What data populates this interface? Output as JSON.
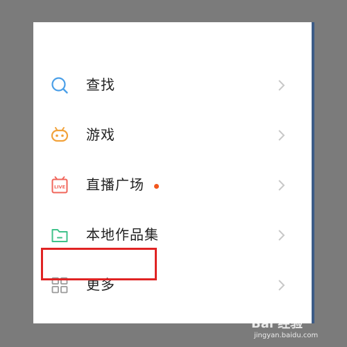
{
  "menu": {
    "items": [
      {
        "label": "查找",
        "icon": "search-icon",
        "icon_color": "#4a9fe8",
        "has_dot": false
      },
      {
        "label": "游戏",
        "icon": "gamepad-icon",
        "icon_color": "#f2a23a",
        "has_dot": false
      },
      {
        "label": "直播广场",
        "icon": "live-tv-icon",
        "icon_color": "#f0645a",
        "has_dot": true,
        "dot_color": "#f2561d"
      },
      {
        "label": "本地作品集",
        "icon": "folder-icon",
        "icon_color": "#3fc28a",
        "has_dot": false
      },
      {
        "label": "更多",
        "icon": "grid-icon",
        "icon_color": "#9a9a9a",
        "has_dot": false
      }
    ]
  },
  "watermark": {
    "main": "Bai 经验",
    "sub": "jingyan.baidu.com"
  },
  "colors": {
    "overlay": "#7b7b7b",
    "panel": "#ffffff",
    "highlight": "#e02323",
    "chevron": "#c8c8c8"
  }
}
